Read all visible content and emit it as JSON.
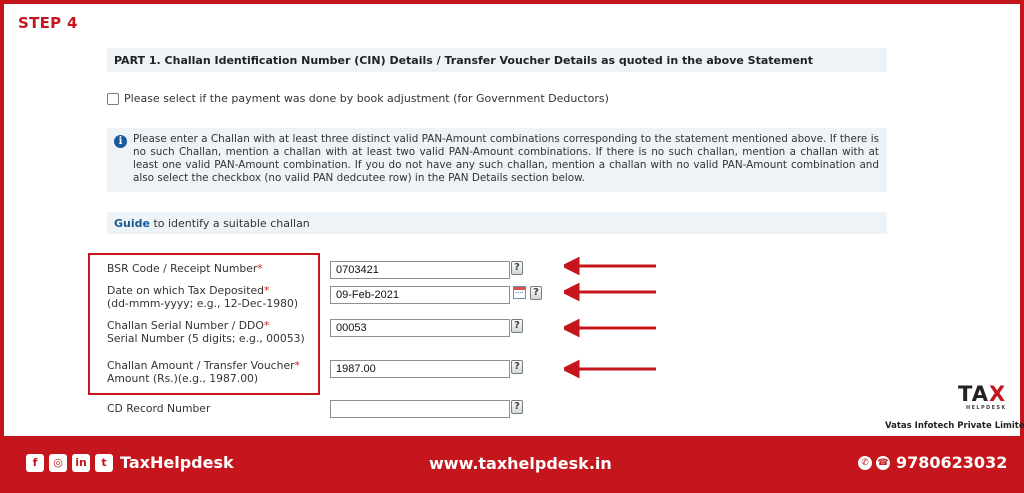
{
  "step": "STEP 4",
  "part_header": "PART 1. Challan Identification Number (CIN) Details / Transfer Voucher Details as quoted in the above Statement",
  "book_adjustment": {
    "label": "Please select if the payment was done by book adjustment (for Government Deductors)",
    "checked": false
  },
  "info": {
    "icon": "info-icon",
    "text": "Please enter a Challan with at least three distinct valid PAN-Amount combinations corresponding to the statement mentioned above. If there is no such Challan, mention a challan with at least two valid PAN-Amount combinations. If there is no such challan, mention a challan with at least one valid PAN-Amount combination. If you do not have any such challan, mention a challan with no valid PAN-Amount combination and also select the checkbox (no valid PAN dedcutee row) in the PAN Details section below."
  },
  "guide": {
    "link": "Guide",
    "rest": " to identify a suitable challan"
  },
  "fields": {
    "bsr": {
      "label": "BSR Code / Receipt Number",
      "req": "*",
      "value": "0703421"
    },
    "date": {
      "label1": "Date on which Tax Deposited",
      "req": "*",
      "label2": "(dd-mmm-yyyy; e.g., 12-Dec-1980)",
      "value": "09-Feb-2021"
    },
    "serial": {
      "label1": "Challan Serial Number / DDO",
      "req": "*",
      "label2": "Serial Number (5 digits; e.g., 00053)",
      "value": "00053"
    },
    "amount": {
      "label1": "Challan Amount / Transfer Voucher",
      "req": "*",
      "label2": "Amount (Rs.)(e.g., 1987.00)",
      "value": "1987.00"
    },
    "cd": {
      "label": "CD Record Number",
      "value": ""
    }
  },
  "help_glyph": "?",
  "logo": {
    "main_a": "TA",
    "main_x": "X",
    "sub": "HELPDESK"
  },
  "company": "Vatas Infotech Private Limited",
  "footer": {
    "icons": {
      "facebook": "f",
      "instagram": "◎",
      "linkedin": "in",
      "twitter": "t"
    },
    "brand": "TaxHelpdesk",
    "website": "www.taxhelpdesk.in",
    "phone_icons": {
      "whatsapp": "✆",
      "call": "☎"
    },
    "phone": "9780623032"
  },
  "colors": {
    "brand_red": "#c4161c",
    "panel": "#eef3f7",
    "link": "#1a5a8f",
    "info_blue": "#1c5aa0"
  }
}
